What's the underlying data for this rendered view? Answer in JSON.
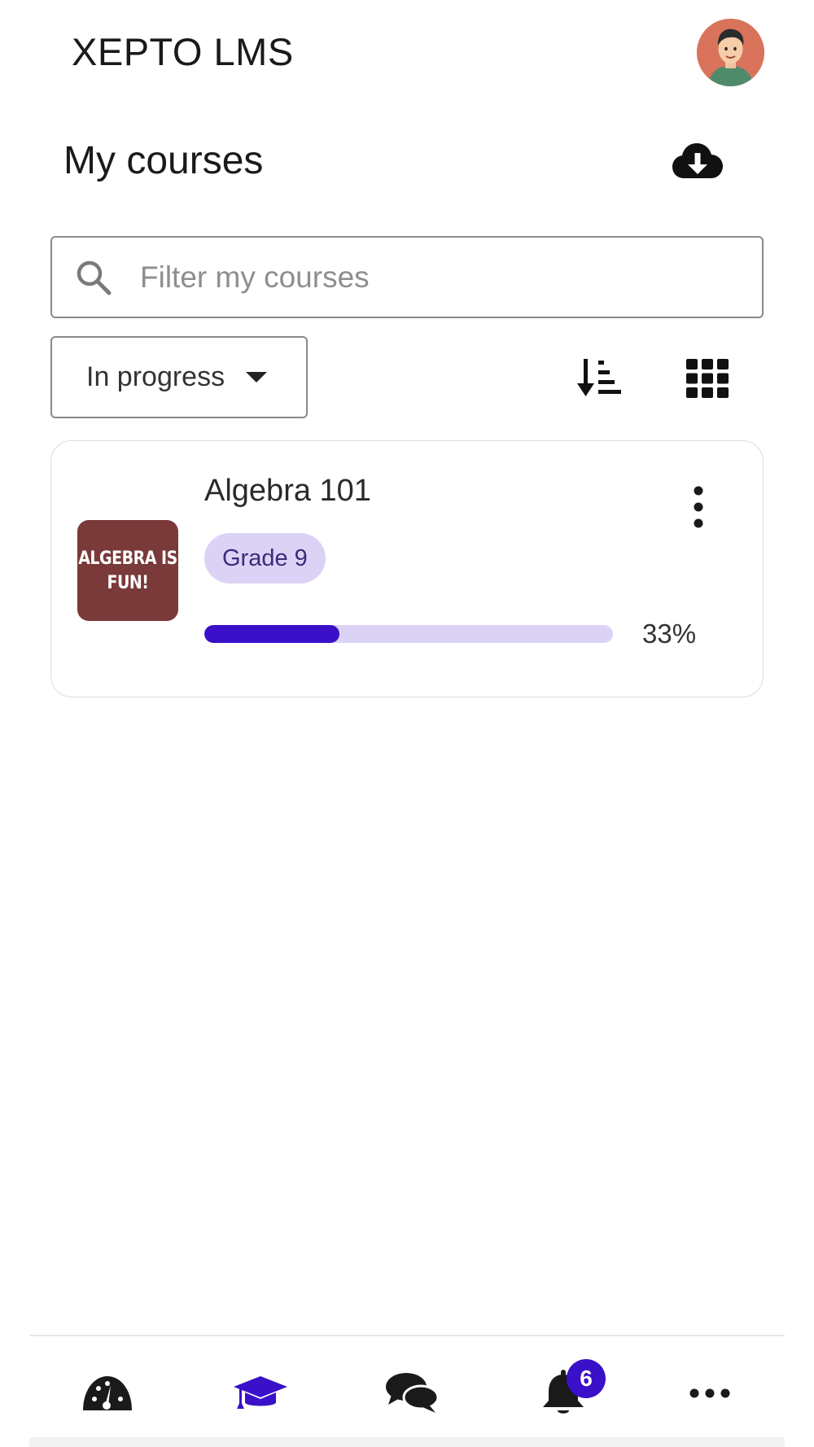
{
  "header": {
    "app_title": "XEPTO LMS"
  },
  "page": {
    "title": "My courses"
  },
  "search": {
    "placeholder": "Filter my courses",
    "value": ""
  },
  "filters": {
    "status_selected": "In progress"
  },
  "courses": [
    {
      "name": "Algebra 101",
      "thumbnail_text": "ALGEBRA IS FUN!",
      "badge": "Grade 9",
      "progress_percent": 33,
      "progress_label": "33%"
    }
  ],
  "bottom_nav": {
    "items": [
      {
        "name": "dashboard",
        "icon": "speedometer-icon",
        "active": false
      },
      {
        "name": "my-courses",
        "icon": "graduation-cap-icon",
        "active": true
      },
      {
        "name": "messages",
        "icon": "chat-bubbles-icon",
        "active": false
      },
      {
        "name": "notifications",
        "icon": "bell-icon",
        "active": false,
        "badge": "6"
      },
      {
        "name": "more",
        "icon": "more-horizontal-icon",
        "active": false
      }
    ]
  },
  "colors": {
    "accent": "#3a10c9",
    "accent_light": "#dcd2f6",
    "thumbnail_bg": "#7a3a3a",
    "avatar_bg": "#d9735c"
  }
}
